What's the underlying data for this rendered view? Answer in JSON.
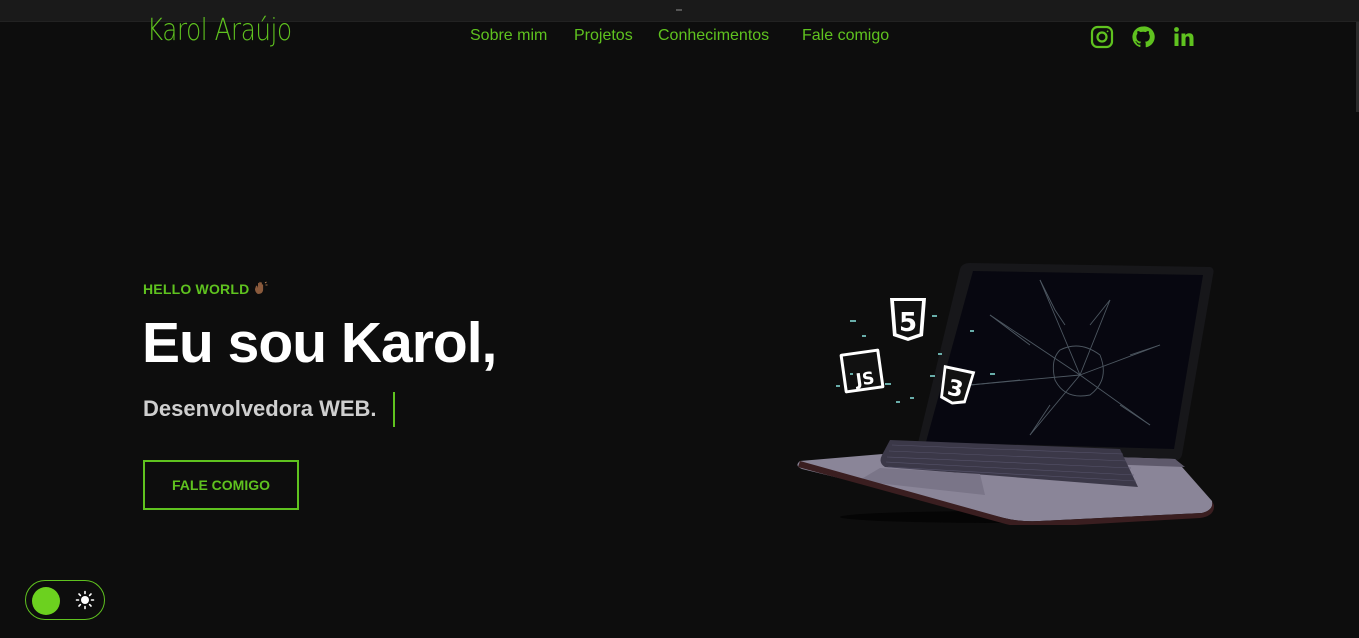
{
  "header": {
    "logo": "Karol Araújo",
    "nav": [
      {
        "label": "Sobre mim"
      },
      {
        "label": "Projetos"
      },
      {
        "label": "Conhecimentos"
      },
      {
        "label": "Fale comigo"
      }
    ],
    "social_icons": [
      "instagram-icon",
      "github-icon",
      "linkedin-icon"
    ]
  },
  "hero": {
    "greeting": "HELLO WORLD",
    "greeting_emoji": "waving-hand",
    "title": "Eu sou Karol,",
    "subtitle": "Desenvolvedora WEB.",
    "cta_label": "FALE COMIGO",
    "image_badges": [
      "5",
      "JS",
      "3"
    ]
  },
  "theme_toggle": {
    "icon": "sun-icon"
  },
  "colors": {
    "accent": "#5fc21f",
    "background": "#0d0d0d",
    "text": "#ffffff",
    "subtitle": "#cfcfcf"
  }
}
